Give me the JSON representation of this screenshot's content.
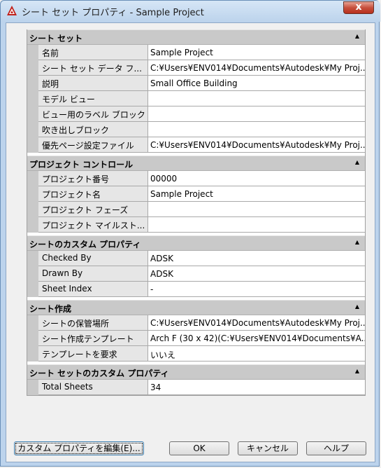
{
  "window": {
    "title": "シート セット プロパティ - Sample Project",
    "close_label": "x"
  },
  "sections": [
    {
      "title": "シート セット",
      "rows": [
        {
          "name": "名前",
          "value": "Sample Project"
        },
        {
          "name": "シート セット データ フ...",
          "value": "C:¥Users¥ENV014¥Documents¥Autodesk¥My Proj..."
        },
        {
          "name": "説明",
          "value": "Small Office Building"
        },
        {
          "name": "モデル ビュー",
          "value": ""
        },
        {
          "name": "ビュー用のラベル ブロック",
          "value": ""
        },
        {
          "name": "吹き出しブロック",
          "value": ""
        },
        {
          "name": "優先ページ設定ファイル",
          "value": "C:¥Users¥ENV014¥Documents¥Autodesk¥My Proj..."
        }
      ]
    },
    {
      "title": "プロジェクト コントロール",
      "rows": [
        {
          "name": "プロジェクト番号",
          "value": "00000"
        },
        {
          "name": "プロジェクト名",
          "value": "Sample Project"
        },
        {
          "name": "プロジェクト フェーズ",
          "value": ""
        },
        {
          "name": "プロジェクト マイルスト...",
          "value": ""
        }
      ]
    },
    {
      "title": "シートのカスタム プロパティ",
      "rows": [
        {
          "name": "Checked By",
          "value": "ADSK"
        },
        {
          "name": "Drawn By",
          "value": "ADSK"
        },
        {
          "name": "Sheet Index",
          "value": "-"
        }
      ]
    },
    {
      "title": "シート作成",
      "rows": [
        {
          "name": "シートの保管場所",
          "value": "C:¥Users¥ENV014¥Documents¥Autodesk¥My Proj..."
        },
        {
          "name": "シート作成テンプレート",
          "value": "Arch F (30 x 42)(C:¥Users¥ENV014¥Documents¥A..."
        },
        {
          "name": "テンプレートを要求",
          "value": "いいえ"
        }
      ]
    },
    {
      "title": "シート セットのカスタム プロパティ",
      "rows": [
        {
          "name": "Total Sheets",
          "value": "34"
        }
      ]
    }
  ],
  "buttons": {
    "edit_custom": "カスタム プロパティを編集(E)...",
    "ok": "OK",
    "cancel": "キャンセル",
    "help": "ヘルプ"
  },
  "icons": {
    "app": "autocad-icon",
    "collapse": "collapse-arrow-icon"
  },
  "colors": {
    "section_header": "#c9c9c9",
    "close_button": "#c7503d"
  }
}
